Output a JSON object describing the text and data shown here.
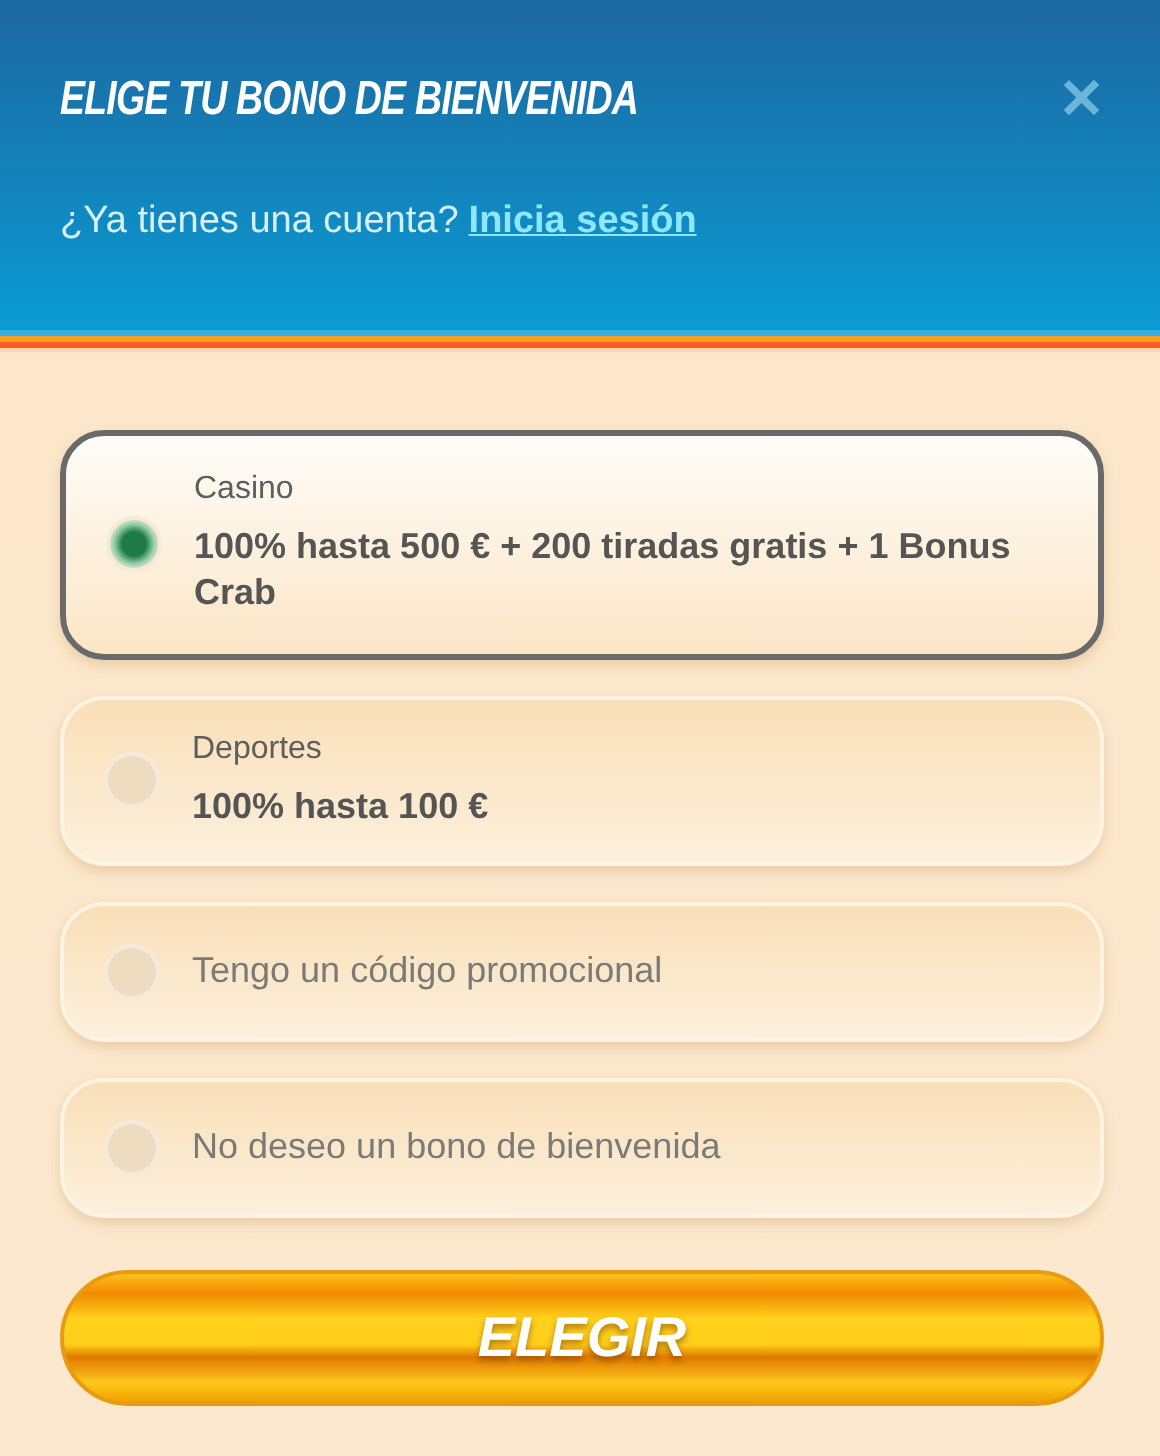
{
  "header": {
    "title": "ELIGE TU BONO DE BIENVENIDA",
    "close": "✕",
    "account_prompt": "¿Ya tienes una cuenta?",
    "login_link": "Inicia sesión"
  },
  "options": [
    {
      "category": "Casino",
      "label": "100% hasta 500 € + 200 tiradas gratis + 1 Bonus Crab",
      "selected": true
    },
    {
      "category": "Deportes",
      "label": "100% hasta 100 €",
      "selected": false
    },
    {
      "label": "Tengo un código promocional",
      "selected": false
    },
    {
      "label": "No deseo un bono de bienvenida",
      "selected": false
    }
  ],
  "submit": "ELEGIR"
}
